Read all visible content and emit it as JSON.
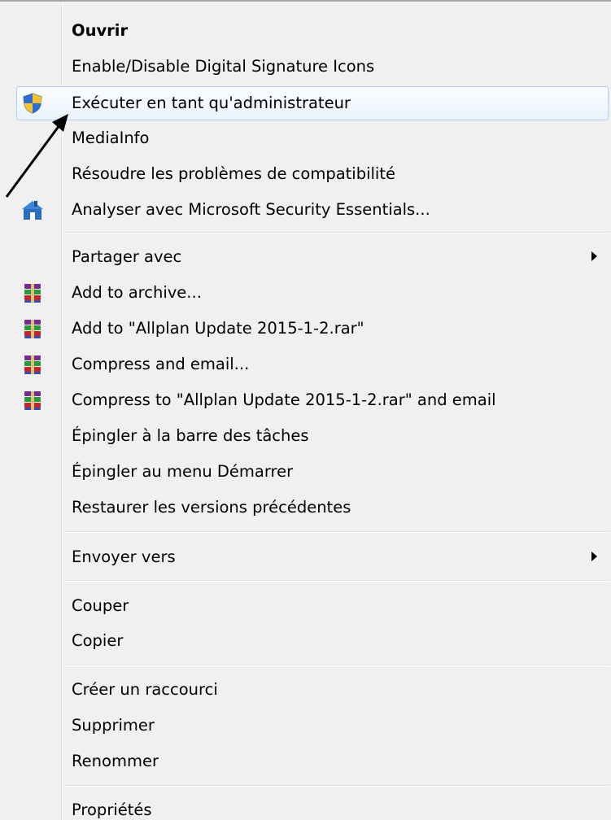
{
  "menu": {
    "items": [
      {
        "label": "Ouvrir"
      },
      {
        "label": "Enable/Disable Digital Signature Icons"
      },
      {
        "label": "Exécuter en tant qu'administrateur",
        "icon": "uac-shield-icon"
      },
      {
        "label": "MediaInfo"
      },
      {
        "label": "Résoudre les problèmes de compatibilité"
      },
      {
        "label": "Analyser avec Microsoft Security Essentials...",
        "icon": "security-essentials-icon"
      },
      {
        "label": "Partager avec"
      },
      {
        "label": "Add to archive...",
        "icon": "winrar-icon"
      },
      {
        "label": "Add to \"Allplan Update 2015-1-2.rar\"",
        "icon": "winrar-icon"
      },
      {
        "label": "Compress and email...",
        "icon": "winrar-icon"
      },
      {
        "label": "Compress to \"Allplan Update 2015-1-2.rar\" and email",
        "icon": "winrar-icon"
      },
      {
        "label": "Épingler à la barre des tâches"
      },
      {
        "label": "Épingler au menu Démarrer"
      },
      {
        "label": "Restaurer les versions précédentes"
      },
      {
        "label": "Envoyer vers"
      },
      {
        "label": "Couper"
      },
      {
        "label": "Copier"
      },
      {
        "label": "Créer un raccourci"
      },
      {
        "label": "Supprimer"
      },
      {
        "label": "Renommer"
      },
      {
        "label": "Propriétés"
      }
    ]
  },
  "colors": {
    "menu_background": "#f0f0f0",
    "highlight_border": "#aecff7",
    "highlight_fill": "#ebf3fd",
    "text": "#000000"
  }
}
